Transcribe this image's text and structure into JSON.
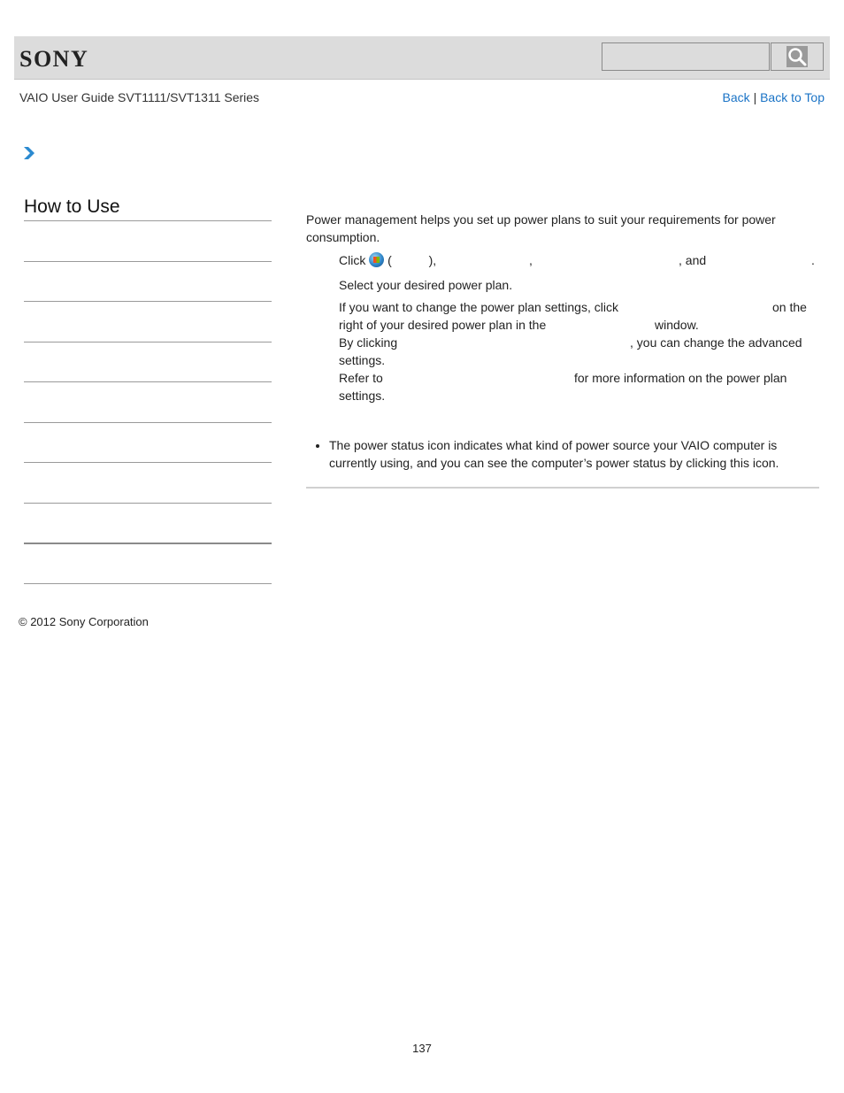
{
  "header": {
    "logo": "SONY",
    "search_placeholder": "",
    "search_button_icon": "magnifier-icon"
  },
  "guide_title": "VAIO User Guide SVT1111/SVT1311 Series",
  "nav": {
    "back": "Back",
    "separator": "|",
    "back_to_top": "Back to Top"
  },
  "breadcrumb_icon": "chevron-right-icon",
  "sidebar": {
    "title": "How to Use",
    "items": [
      "",
      "",
      "",
      "",
      "",
      "",
      "",
      "",
      ""
    ]
  },
  "content": {
    "intro": "Power management helps you set up power plans to suit your requirements for power consumption.",
    "step1": {
      "click": "Click",
      "open_paren": "(",
      "close_paren": "),",
      "comma": ",",
      "and": ", and",
      "period": "."
    },
    "step2": "Select your desired power plan.",
    "step3": {
      "line1_a": "If you want to change the power plan settings, click",
      "line1_b": "on the",
      "line2_a": "right of your desired power plan in the",
      "line2_b": "window.",
      "line3_a": "By clicking",
      "line3_b": ", you can change the advanced",
      "line4": "settings.",
      "line5_a": "Refer to",
      "line5_b": "for more information on the power plan",
      "line6": "settings."
    },
    "note": "The power status icon indicates what kind of power source your VAIO computer is currently using, and you can see the computer’s power status by clicking this icon."
  },
  "footer": {
    "copyright": "© 2012 Sony Corporation",
    "page_number": "137"
  }
}
